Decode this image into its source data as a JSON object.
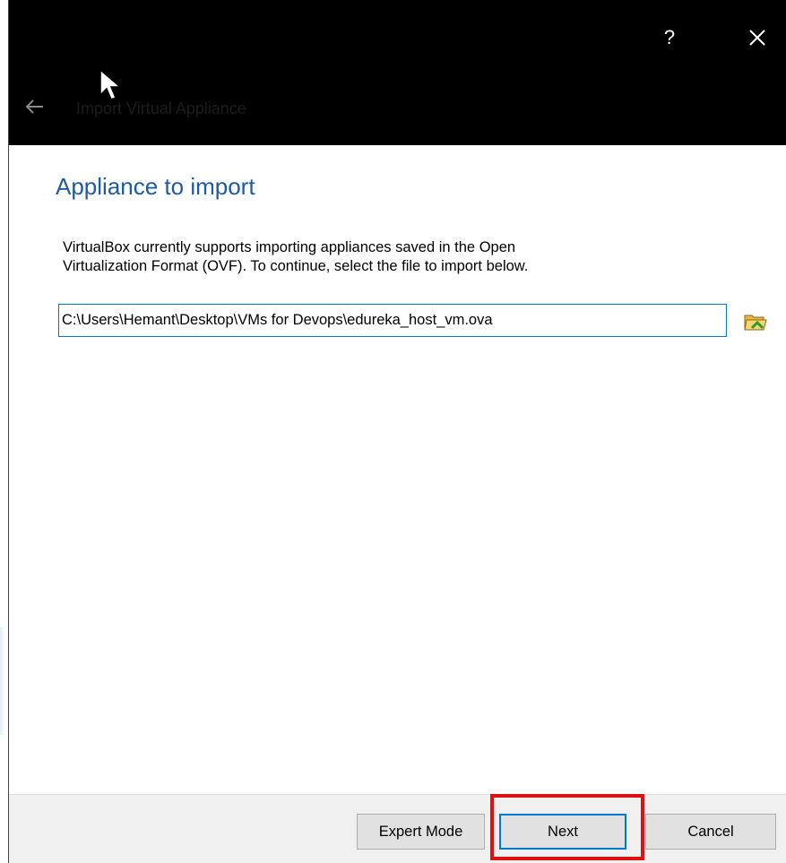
{
  "window": {
    "title": "Import Virtual Appliance",
    "help_label": "?",
    "close_icon": "close-icon",
    "back_icon": "back-arrow-icon"
  },
  "page": {
    "heading": "Appliance to import",
    "description_line1": "VirtualBox currently supports importing appliances saved in the Open",
    "description_line2": "Virtualization Format (OVF). To continue, select the file to import below.",
    "file_path": "C:\\Users\\Hemant\\Desktop\\VMs for Devops\\edureka_host_vm.ova",
    "browse_icon": "folder-open-icon"
  },
  "buttons": {
    "expert_mode": "Expert Mode",
    "next": "Next",
    "cancel": "Cancel"
  },
  "colors": {
    "titlebar": "#000000",
    "heading": "#1e5aa6",
    "focus_border": "#0078d7",
    "highlight": "#e01010"
  }
}
